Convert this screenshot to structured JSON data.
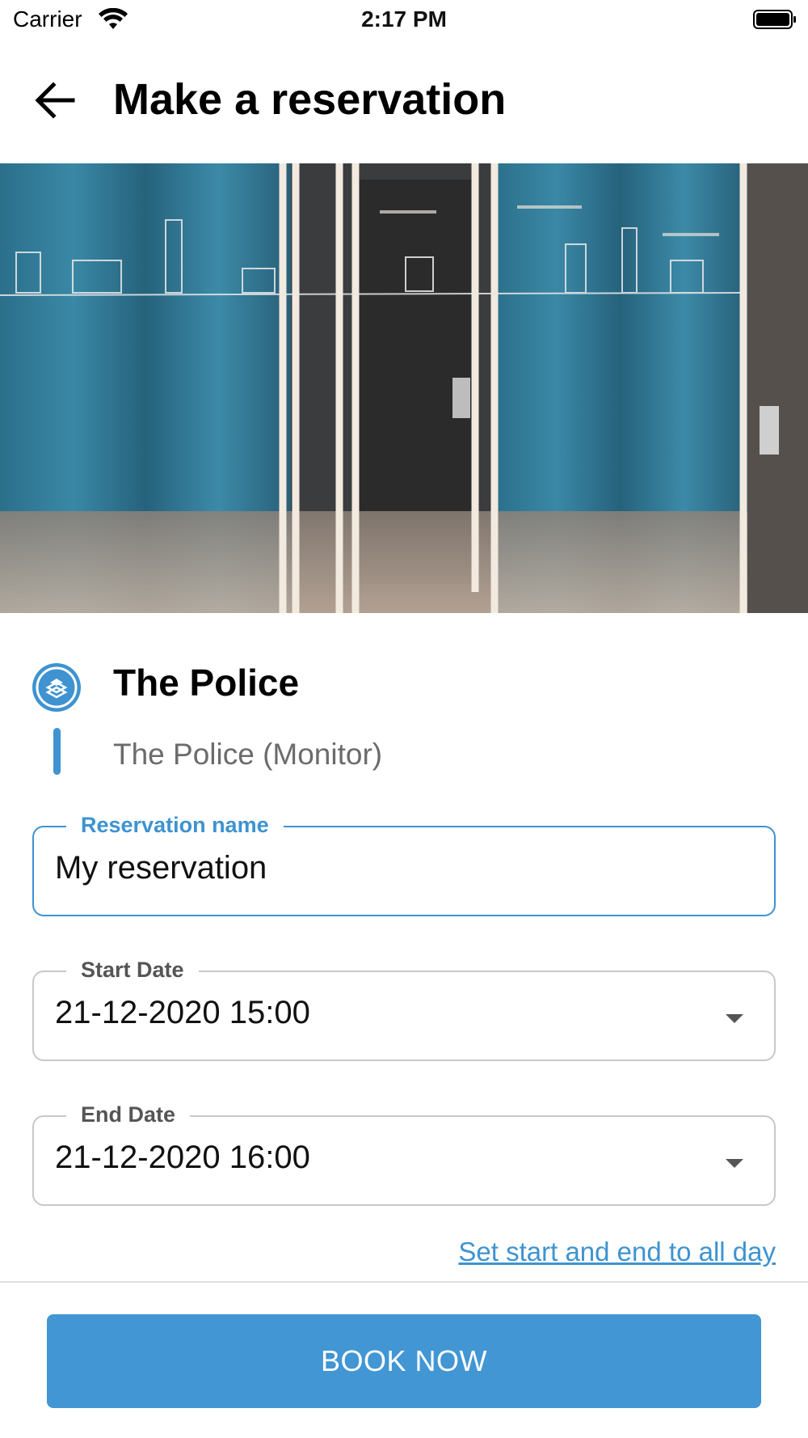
{
  "status_bar": {
    "carrier": "Carrier",
    "time": "2:17 PM"
  },
  "header": {
    "title": "Make a reservation",
    "back_icon": "arrow-left-icon"
  },
  "room": {
    "name": "The Police",
    "subtitle": "The Police (Monitor)",
    "icon": "room-badge-icon"
  },
  "form": {
    "reservation_name": {
      "label": "Reservation name",
      "value": "My reservation"
    },
    "start_date": {
      "label": "Start Date",
      "value": "21-12-2020 15:00"
    },
    "end_date": {
      "label": "End Date",
      "value": "21-12-2020 16:00"
    },
    "all_day_link": "Set start and end to all day"
  },
  "actions": {
    "book_label": "BOOK NOW"
  },
  "colors": {
    "accent": "#3e93d0",
    "button": "#4196d3"
  }
}
